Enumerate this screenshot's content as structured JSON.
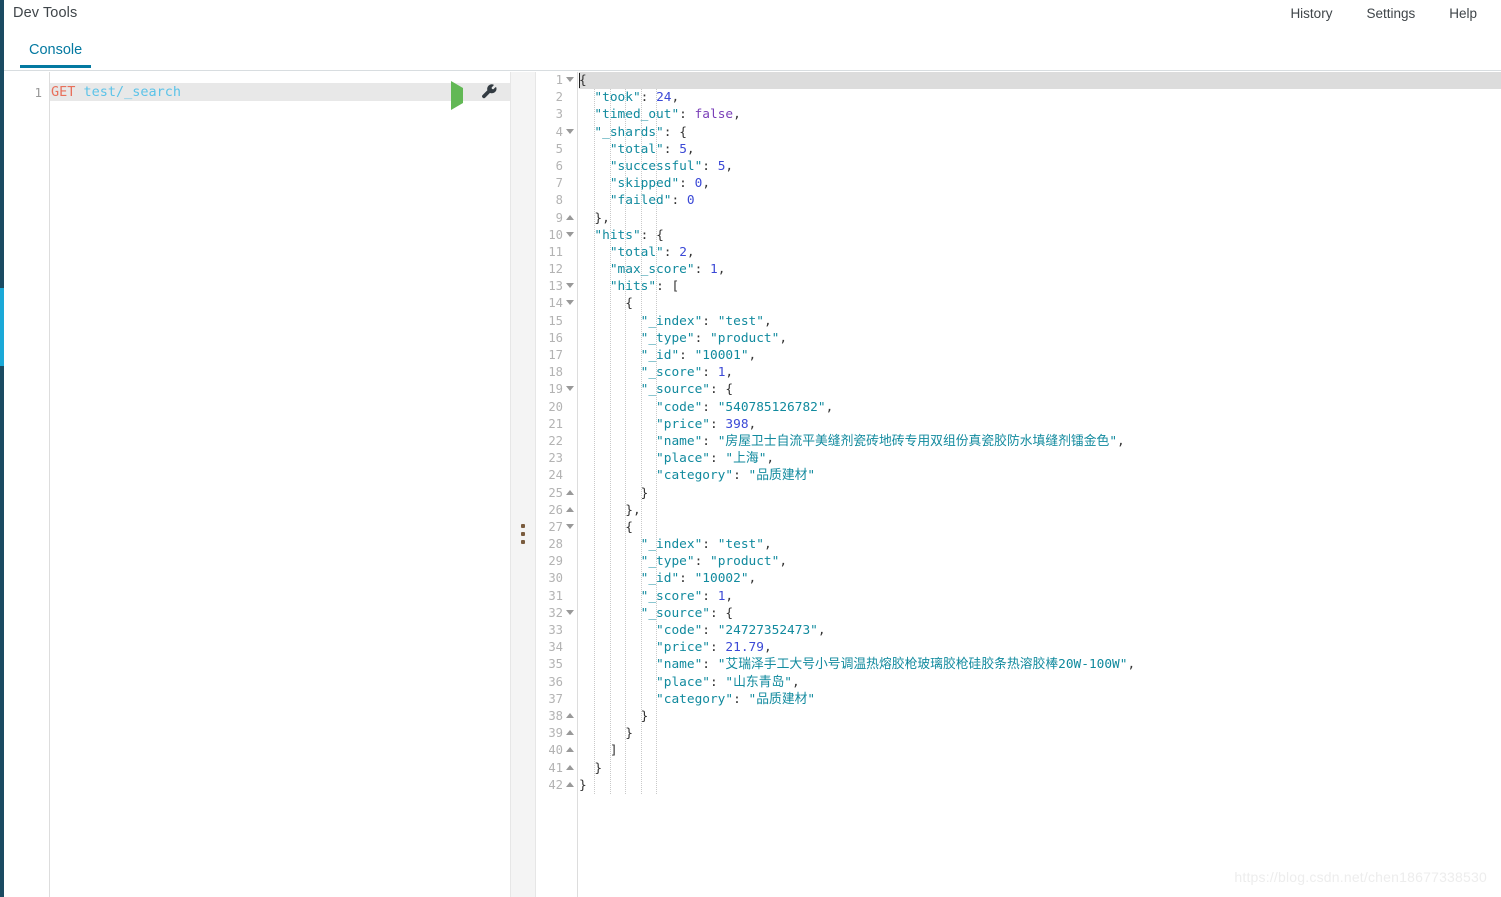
{
  "app": {
    "title": "Dev Tools",
    "accent_color": "#0479a1",
    "rail_color": "#1b4b62",
    "rail_highlight_color": "#1ba9d8"
  },
  "topnav": {
    "items": [
      {
        "label": "History"
      },
      {
        "label": "Settings"
      },
      {
        "label": "Help"
      }
    ]
  },
  "tabs": [
    {
      "label": "Console",
      "active": true
    }
  ],
  "request_editor": {
    "line_number": "1",
    "method": "GET",
    "path": "test/_search",
    "run_icon": "play-icon",
    "wrench_icon": "wrench-icon"
  },
  "splitter": {
    "handle_icon": "drag-handle-icon"
  },
  "response_editor": {
    "total_lines": 42,
    "lines": [
      {
        "n": "1",
        "indent": 0,
        "fold": "open",
        "tokens": [
          {
            "t": "brace",
            "v": "{"
          }
        ]
      },
      {
        "n": "2",
        "indent": 1,
        "fold": "",
        "tokens": [
          {
            "t": "key",
            "v": "\"took\""
          },
          {
            "t": "punc",
            "v": ": "
          },
          {
            "t": "num",
            "v": "24"
          },
          {
            "t": "punc",
            "v": ","
          }
        ]
      },
      {
        "n": "3",
        "indent": 1,
        "fold": "",
        "tokens": [
          {
            "t": "key",
            "v": "\"timed_out\""
          },
          {
            "t": "punc",
            "v": ": "
          },
          {
            "t": "bool",
            "v": "false"
          },
          {
            "t": "punc",
            "v": ","
          }
        ]
      },
      {
        "n": "4",
        "indent": 1,
        "fold": "open",
        "tokens": [
          {
            "t": "key",
            "v": "\"_shards\""
          },
          {
            "t": "punc",
            "v": ": "
          },
          {
            "t": "brace",
            "v": "{"
          }
        ]
      },
      {
        "n": "5",
        "indent": 2,
        "fold": "",
        "tokens": [
          {
            "t": "key",
            "v": "\"total\""
          },
          {
            "t": "punc",
            "v": ": "
          },
          {
            "t": "num",
            "v": "5"
          },
          {
            "t": "punc",
            "v": ","
          }
        ]
      },
      {
        "n": "6",
        "indent": 2,
        "fold": "",
        "tokens": [
          {
            "t": "key",
            "v": "\"successful\""
          },
          {
            "t": "punc",
            "v": ": "
          },
          {
            "t": "num",
            "v": "5"
          },
          {
            "t": "punc",
            "v": ","
          }
        ]
      },
      {
        "n": "7",
        "indent": 2,
        "fold": "",
        "tokens": [
          {
            "t": "key",
            "v": "\"skipped\""
          },
          {
            "t": "punc",
            "v": ": "
          },
          {
            "t": "num",
            "v": "0"
          },
          {
            "t": "punc",
            "v": ","
          }
        ]
      },
      {
        "n": "8",
        "indent": 2,
        "fold": "",
        "tokens": [
          {
            "t": "key",
            "v": "\"failed\""
          },
          {
            "t": "punc",
            "v": ": "
          },
          {
            "t": "num",
            "v": "0"
          }
        ]
      },
      {
        "n": "9",
        "indent": 1,
        "fold": "close",
        "tokens": [
          {
            "t": "brace",
            "v": "}"
          },
          {
            "t": "punc",
            "v": ","
          }
        ]
      },
      {
        "n": "10",
        "indent": 1,
        "fold": "open",
        "tokens": [
          {
            "t": "key",
            "v": "\"hits\""
          },
          {
            "t": "punc",
            "v": ": "
          },
          {
            "t": "brace",
            "v": "{"
          }
        ]
      },
      {
        "n": "11",
        "indent": 2,
        "fold": "",
        "tokens": [
          {
            "t": "key",
            "v": "\"total\""
          },
          {
            "t": "punc",
            "v": ": "
          },
          {
            "t": "num",
            "v": "2"
          },
          {
            "t": "punc",
            "v": ","
          }
        ]
      },
      {
        "n": "12",
        "indent": 2,
        "fold": "",
        "tokens": [
          {
            "t": "key",
            "v": "\"max_score\""
          },
          {
            "t": "punc",
            "v": ": "
          },
          {
            "t": "num",
            "v": "1"
          },
          {
            "t": "punc",
            "v": ","
          }
        ]
      },
      {
        "n": "13",
        "indent": 2,
        "fold": "open",
        "tokens": [
          {
            "t": "key",
            "v": "\"hits\""
          },
          {
            "t": "punc",
            "v": ": "
          },
          {
            "t": "brace",
            "v": "["
          }
        ]
      },
      {
        "n": "14",
        "indent": 3,
        "fold": "open",
        "tokens": [
          {
            "t": "brace",
            "v": "{"
          }
        ]
      },
      {
        "n": "15",
        "indent": 4,
        "fold": "",
        "tokens": [
          {
            "t": "key",
            "v": "\"_index\""
          },
          {
            "t": "punc",
            "v": ": "
          },
          {
            "t": "str",
            "v": "\"test\""
          },
          {
            "t": "punc",
            "v": ","
          }
        ]
      },
      {
        "n": "16",
        "indent": 4,
        "fold": "",
        "tokens": [
          {
            "t": "key",
            "v": "\"_type\""
          },
          {
            "t": "punc",
            "v": ": "
          },
          {
            "t": "str",
            "v": "\"product\""
          },
          {
            "t": "punc",
            "v": ","
          }
        ]
      },
      {
        "n": "17",
        "indent": 4,
        "fold": "",
        "tokens": [
          {
            "t": "key",
            "v": "\"_id\""
          },
          {
            "t": "punc",
            "v": ": "
          },
          {
            "t": "str",
            "v": "\"10001\""
          },
          {
            "t": "punc",
            "v": ","
          }
        ]
      },
      {
        "n": "18",
        "indent": 4,
        "fold": "",
        "tokens": [
          {
            "t": "key",
            "v": "\"_score\""
          },
          {
            "t": "punc",
            "v": ": "
          },
          {
            "t": "num",
            "v": "1"
          },
          {
            "t": "punc",
            "v": ","
          }
        ]
      },
      {
        "n": "19",
        "indent": 4,
        "fold": "open",
        "tokens": [
          {
            "t": "key",
            "v": "\"_source\""
          },
          {
            "t": "punc",
            "v": ": "
          },
          {
            "t": "brace",
            "v": "{"
          }
        ]
      },
      {
        "n": "20",
        "indent": 5,
        "fold": "",
        "tokens": [
          {
            "t": "key",
            "v": "\"code\""
          },
          {
            "t": "punc",
            "v": ": "
          },
          {
            "t": "str",
            "v": "\"540785126782\""
          },
          {
            "t": "punc",
            "v": ","
          }
        ]
      },
      {
        "n": "21",
        "indent": 5,
        "fold": "",
        "tokens": [
          {
            "t": "key",
            "v": "\"price\""
          },
          {
            "t": "punc",
            "v": ": "
          },
          {
            "t": "num",
            "v": "398"
          },
          {
            "t": "punc",
            "v": ","
          }
        ]
      },
      {
        "n": "22",
        "indent": 5,
        "fold": "",
        "tokens": [
          {
            "t": "key",
            "v": "\"name\""
          },
          {
            "t": "punc",
            "v": ": "
          },
          {
            "t": "str",
            "v": "\"房屋卫士自流平美缝剂瓷砖地砖专用双组份真瓷胶防水填缝剂镭金色\""
          },
          {
            "t": "punc",
            "v": ","
          }
        ]
      },
      {
        "n": "23",
        "indent": 5,
        "fold": "",
        "tokens": [
          {
            "t": "key",
            "v": "\"place\""
          },
          {
            "t": "punc",
            "v": ": "
          },
          {
            "t": "str",
            "v": "\"上海\""
          },
          {
            "t": "punc",
            "v": ","
          }
        ]
      },
      {
        "n": "24",
        "indent": 5,
        "fold": "",
        "tokens": [
          {
            "t": "key",
            "v": "\"category\""
          },
          {
            "t": "punc",
            "v": ": "
          },
          {
            "t": "str",
            "v": "\"品质建材\""
          }
        ]
      },
      {
        "n": "25",
        "indent": 4,
        "fold": "close",
        "tokens": [
          {
            "t": "brace",
            "v": "}"
          }
        ]
      },
      {
        "n": "26",
        "indent": 3,
        "fold": "close",
        "tokens": [
          {
            "t": "brace",
            "v": "}"
          },
          {
            "t": "punc",
            "v": ","
          }
        ]
      },
      {
        "n": "27",
        "indent": 3,
        "fold": "open",
        "tokens": [
          {
            "t": "brace",
            "v": "{"
          }
        ]
      },
      {
        "n": "28",
        "indent": 4,
        "fold": "",
        "tokens": [
          {
            "t": "key",
            "v": "\"_index\""
          },
          {
            "t": "punc",
            "v": ": "
          },
          {
            "t": "str",
            "v": "\"test\""
          },
          {
            "t": "punc",
            "v": ","
          }
        ]
      },
      {
        "n": "29",
        "indent": 4,
        "fold": "",
        "tokens": [
          {
            "t": "key",
            "v": "\"_type\""
          },
          {
            "t": "punc",
            "v": ": "
          },
          {
            "t": "str",
            "v": "\"product\""
          },
          {
            "t": "punc",
            "v": ","
          }
        ]
      },
      {
        "n": "30",
        "indent": 4,
        "fold": "",
        "tokens": [
          {
            "t": "key",
            "v": "\"_id\""
          },
          {
            "t": "punc",
            "v": ": "
          },
          {
            "t": "str",
            "v": "\"10002\""
          },
          {
            "t": "punc",
            "v": ","
          }
        ]
      },
      {
        "n": "31",
        "indent": 4,
        "fold": "",
        "tokens": [
          {
            "t": "key",
            "v": "\"_score\""
          },
          {
            "t": "punc",
            "v": ": "
          },
          {
            "t": "num",
            "v": "1"
          },
          {
            "t": "punc",
            "v": ","
          }
        ]
      },
      {
        "n": "32",
        "indent": 4,
        "fold": "open",
        "tokens": [
          {
            "t": "key",
            "v": "\"_source\""
          },
          {
            "t": "punc",
            "v": ": "
          },
          {
            "t": "brace",
            "v": "{"
          }
        ]
      },
      {
        "n": "33",
        "indent": 5,
        "fold": "",
        "tokens": [
          {
            "t": "key",
            "v": "\"code\""
          },
          {
            "t": "punc",
            "v": ": "
          },
          {
            "t": "str",
            "v": "\"24727352473\""
          },
          {
            "t": "punc",
            "v": ","
          }
        ]
      },
      {
        "n": "34",
        "indent": 5,
        "fold": "",
        "tokens": [
          {
            "t": "key",
            "v": "\"price\""
          },
          {
            "t": "punc",
            "v": ": "
          },
          {
            "t": "num",
            "v": "21.79"
          },
          {
            "t": "punc",
            "v": ","
          }
        ]
      },
      {
        "n": "35",
        "indent": 5,
        "fold": "",
        "tokens": [
          {
            "t": "key",
            "v": "\"name\""
          },
          {
            "t": "punc",
            "v": ": "
          },
          {
            "t": "str",
            "v": "\"艾瑞泽手工大号小号调温热熔胶枪玻璃胶枪硅胶条热溶胶棒20W-100W\""
          },
          {
            "t": "punc",
            "v": ","
          }
        ]
      },
      {
        "n": "36",
        "indent": 5,
        "fold": "",
        "tokens": [
          {
            "t": "key",
            "v": "\"place\""
          },
          {
            "t": "punc",
            "v": ": "
          },
          {
            "t": "str",
            "v": "\"山东青岛\""
          },
          {
            "t": "punc",
            "v": ","
          }
        ]
      },
      {
        "n": "37",
        "indent": 5,
        "fold": "",
        "tokens": [
          {
            "t": "key",
            "v": "\"category\""
          },
          {
            "t": "punc",
            "v": ": "
          },
          {
            "t": "str",
            "v": "\"品质建材\""
          }
        ]
      },
      {
        "n": "38",
        "indent": 4,
        "fold": "close",
        "tokens": [
          {
            "t": "brace",
            "v": "}"
          }
        ]
      },
      {
        "n": "39",
        "indent": 3,
        "fold": "close",
        "tokens": [
          {
            "t": "brace",
            "v": "}"
          }
        ]
      },
      {
        "n": "40",
        "indent": 2,
        "fold": "close",
        "tokens": [
          {
            "t": "brace",
            "v": "]"
          }
        ]
      },
      {
        "n": "41",
        "indent": 1,
        "fold": "close",
        "tokens": [
          {
            "t": "brace",
            "v": "}"
          }
        ]
      },
      {
        "n": "42",
        "indent": 0,
        "fold": "close",
        "tokens": [
          {
            "t": "brace",
            "v": "}"
          }
        ]
      }
    ]
  },
  "watermark": {
    "text": "https://blog.csdn.net/chen18677338530"
  }
}
